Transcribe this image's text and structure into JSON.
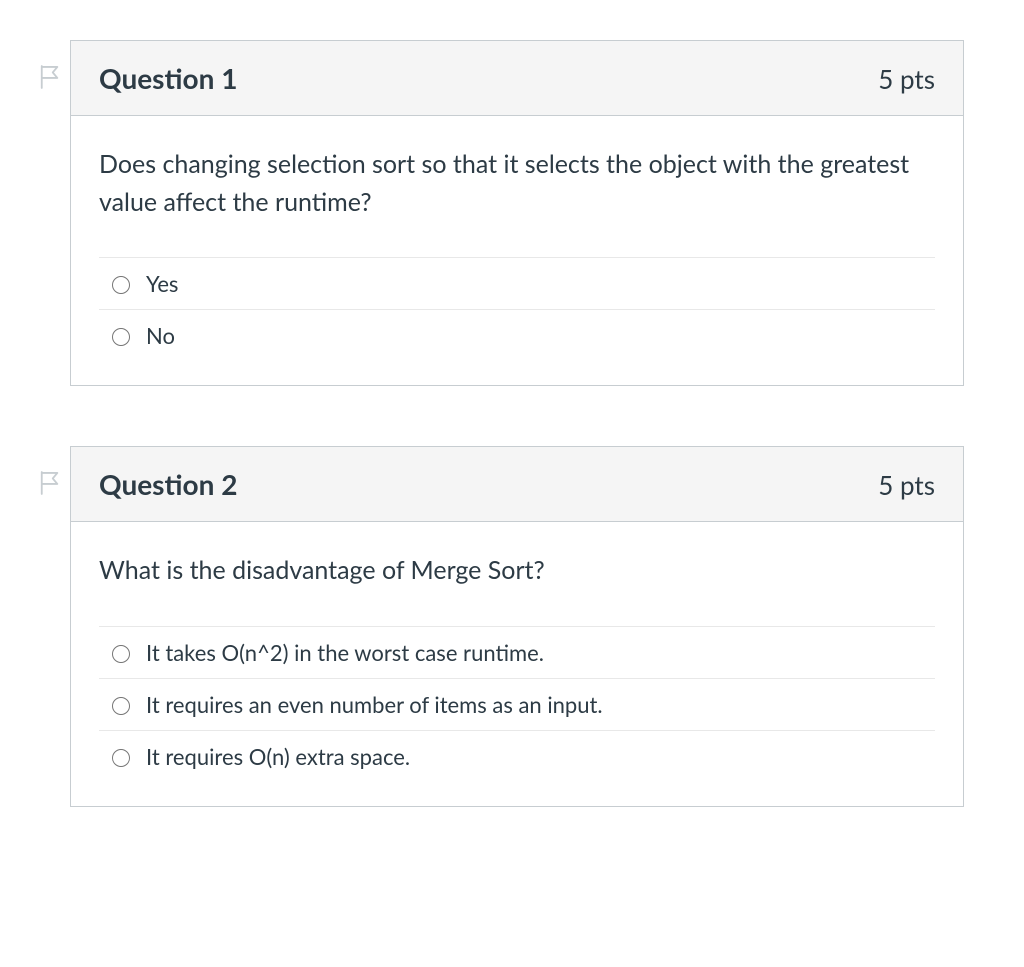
{
  "questions": [
    {
      "title": "Question 1",
      "points": "5 pts",
      "prompt": "Does changing selection sort so that it selects the object with the greatest value affect the runtime?",
      "options": [
        {
          "label": "Yes"
        },
        {
          "label": "No"
        }
      ]
    },
    {
      "title": "Question 2",
      "points": "5 pts",
      "prompt": "What is the disadvantage of Merge Sort?",
      "options": [
        {
          "label": "It takes O(n^2) in the worst case runtime."
        },
        {
          "label": "It requires an even number of items as an input."
        },
        {
          "label": "It requires O(n) extra space."
        }
      ]
    }
  ]
}
